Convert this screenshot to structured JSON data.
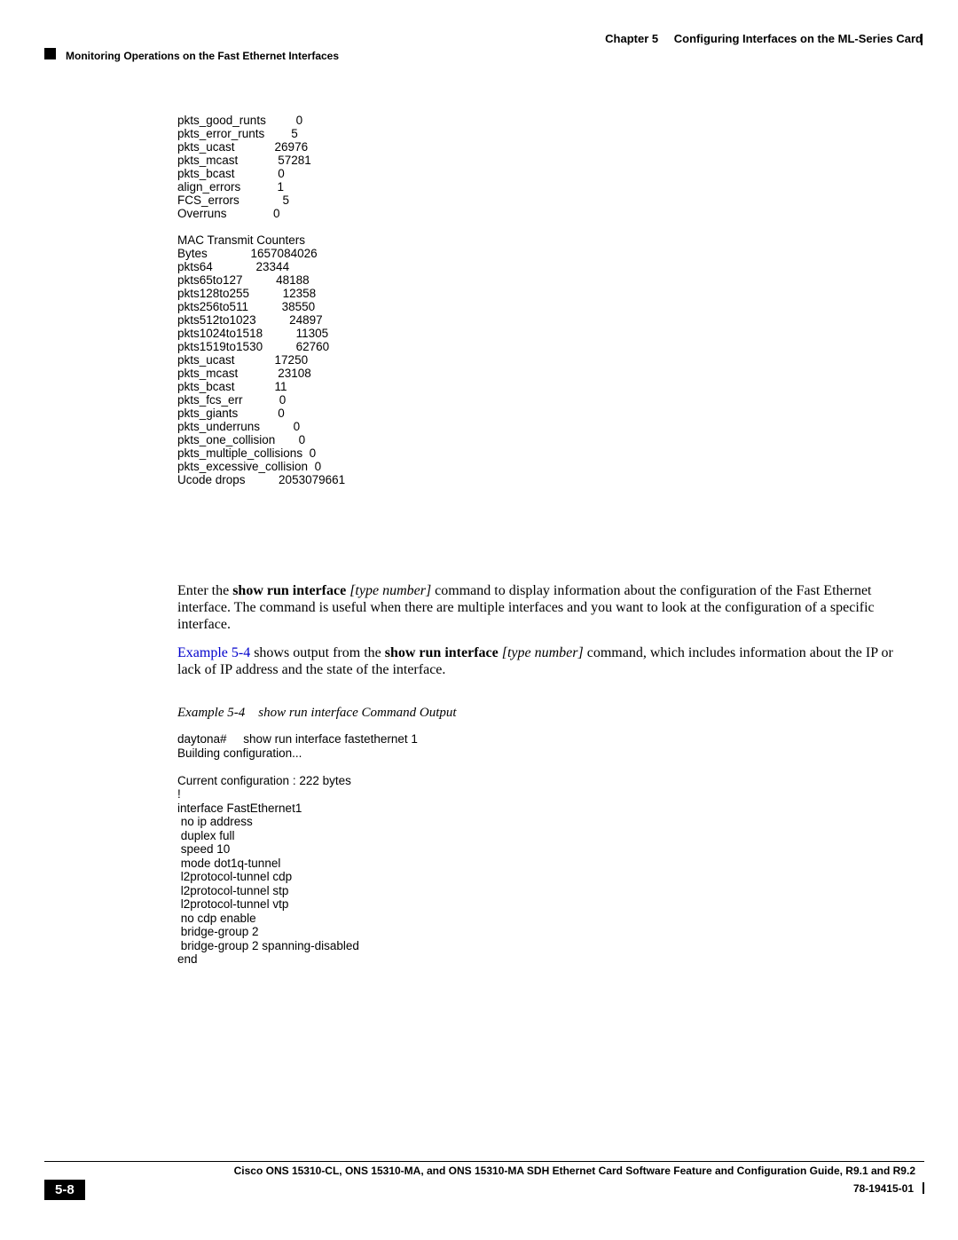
{
  "header": {
    "chapter_label": "Chapter 5",
    "chapter_title": "Configuring Interfaces on the ML-Series Card",
    "section_title": "Monitoring Operations on the Fast Ethernet Interfaces"
  },
  "cli_output_1": "pkts_good_runts         0\npkts_error_runts        5\npkts_ucast            26976\npkts_mcast            57281\npkts_bcast             0\nalign_errors           1\nFCS_errors             5\nOverruns              0\n\nMAC Transmit Counters\nBytes             1657084026\npkts64             23344\npkts65to127          48188\npkts128to255          12358\npkts256to511          38550\npkts512to1023          24897\npkts1024to1518          11305\npkts1519to1530          62760\npkts_ucast            17250\npkts_mcast            23108\npkts_bcast            11\npkts_fcs_err           0\npkts_giants            0\npkts_underruns          0\npkts_one_collision       0\npkts_multiple_collisions  0\npkts_excessive_collision  0\nUcode drops          2053079661",
  "para1": {
    "t1": "Enter the ",
    "cmd1": "show run interface ",
    "arg1": "[type number] ",
    "t2": "command to display information about the configuration of the Fast Ethernet interface. The command is useful when there are multiple interfaces and you want to look at the configuration of a specific interface."
  },
  "para2": {
    "link": "Example 5-4",
    "t1": " shows output from the ",
    "cmd1": "show run interface ",
    "arg1": "[type number] ",
    "t2": "command, which includes information about the IP or lack of IP address and the state of the interface."
  },
  "example_caption": {
    "label": "Example 5-4",
    "title": "show run interface Command Output"
  },
  "cli_output_2": "daytona#     show run interface fastethernet 1\nBuilding configuration...\n\nCurrent configuration : 222 bytes\n!\ninterface FastEthernet1\n no ip address\n duplex full\n speed 10\n mode dot1q-tunnel\n l2protocol-tunnel cdp\n l2protocol-tunnel stp\n l2protocol-tunnel vtp\n no cdp enable\n bridge-group 2\n bridge-group 2 spanning-disabled\nend",
  "footer": {
    "guide_title": "Cisco ONS 15310-CL, ONS 15310-MA, and ONS 15310-MA SDH Ethernet Card Software Feature and Configuration Guide, R9.1 and R9.2",
    "page_number": "5-8",
    "doc_number": "78-19415-01"
  },
  "chart_data": {
    "type": "table",
    "tables": [
      {
        "name": "MAC Receive Counters (partial)",
        "rows": [
          {
            "counter": "pkts_good_runts",
            "value": 0
          },
          {
            "counter": "pkts_error_runts",
            "value": 5
          },
          {
            "counter": "pkts_ucast",
            "value": 26976
          },
          {
            "counter": "pkts_mcast",
            "value": 57281
          },
          {
            "counter": "pkts_bcast",
            "value": 0
          },
          {
            "counter": "align_errors",
            "value": 1
          },
          {
            "counter": "FCS_errors",
            "value": 5
          },
          {
            "counter": "Overruns",
            "value": 0
          }
        ]
      },
      {
        "name": "MAC Transmit Counters",
        "rows": [
          {
            "counter": "Bytes",
            "value": 1657084026
          },
          {
            "counter": "pkts64",
            "value": 23344
          },
          {
            "counter": "pkts65to127",
            "value": 48188
          },
          {
            "counter": "pkts128to255",
            "value": 12358
          },
          {
            "counter": "pkts256to511",
            "value": 38550
          },
          {
            "counter": "pkts512to1023",
            "value": 24897
          },
          {
            "counter": "pkts1024to1518",
            "value": 11305
          },
          {
            "counter": "pkts1519to1530",
            "value": 62760
          },
          {
            "counter": "pkts_ucast",
            "value": 17250
          },
          {
            "counter": "pkts_mcast",
            "value": 23108
          },
          {
            "counter": "pkts_bcast",
            "value": 11
          },
          {
            "counter": "pkts_fcs_err",
            "value": 0
          },
          {
            "counter": "pkts_giants",
            "value": 0
          },
          {
            "counter": "pkts_underruns",
            "value": 0
          },
          {
            "counter": "pkts_one_collision",
            "value": 0
          },
          {
            "counter": "pkts_multiple_collisions",
            "value": 0
          },
          {
            "counter": "pkts_excessive_collision",
            "value": 0
          },
          {
            "counter": "Ucode drops",
            "value": 2053079661
          }
        ]
      }
    ]
  }
}
